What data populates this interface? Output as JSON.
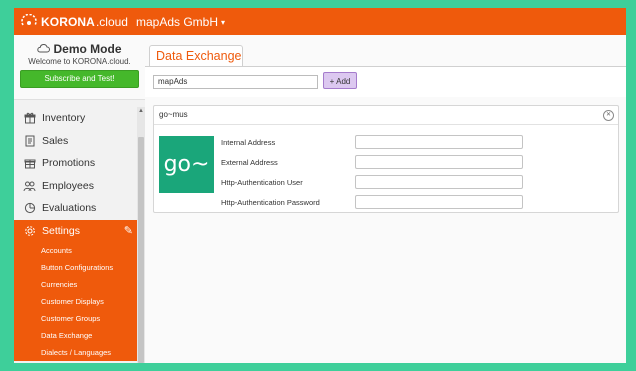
{
  "header": {
    "brand_strong": "KORONA",
    "brand_light": ".cloud",
    "company": "mapAds GmbH",
    "company_caret": "▾"
  },
  "demo": {
    "title": "Demo Mode",
    "subtitle": "Welcome to KORONA.cloud.",
    "button": "Subscribe and Test!"
  },
  "menu": {
    "items": [
      {
        "label": "Inventory"
      },
      {
        "label": "Sales"
      },
      {
        "label": "Promotions"
      },
      {
        "label": "Employees"
      },
      {
        "label": "Evaluations"
      },
      {
        "label": "Settings"
      }
    ],
    "settings_sub": [
      "Accounts",
      "Button Configurations",
      "Currencies",
      "Customer Displays",
      "Customer Groups",
      "Data Exchange",
      "Dialects / Languages"
    ]
  },
  "main": {
    "tab": "Data Exchange",
    "search_value": "mapAds",
    "add_button": "+ Add",
    "card": {
      "title": "go~mus",
      "logo_text": "go~",
      "fields": [
        {
          "label": "Internal Address",
          "value": ""
        },
        {
          "label": "External Address",
          "value": ""
        },
        {
          "label": "Http-Authentication User",
          "value": ""
        },
        {
          "label": "Http-Authentication Password",
          "value": ""
        }
      ]
    }
  },
  "colors": {
    "accent": "#ef5a0c",
    "background": "#3ecf9a",
    "logo_bg": "#1aa67a",
    "subscribe": "#45b82b",
    "add_button": "#dcc8f0"
  }
}
